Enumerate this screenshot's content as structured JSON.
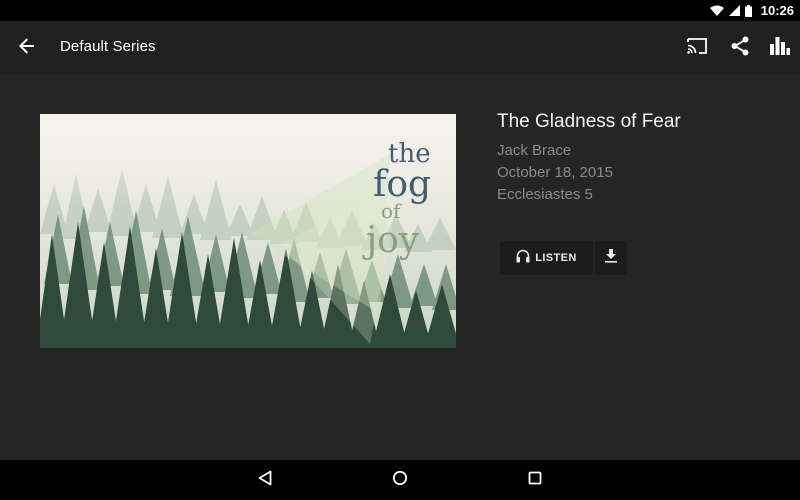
{
  "status_bar": {
    "time": "10:26",
    "icons": [
      "wifi-icon",
      "cellular-icon",
      "battery-icon"
    ]
  },
  "app_bar": {
    "title": "Default Series",
    "actions": [
      "cast-icon",
      "share-icon",
      "stats-icon"
    ]
  },
  "sermon": {
    "title": "The Gladness of Fear",
    "speaker": "Jack Brace",
    "date": "October 18, 2015",
    "scripture": "Ecclesiastes 5"
  },
  "artwork": {
    "words": [
      "the",
      "fog",
      "of",
      "joy"
    ]
  },
  "buttons": {
    "listen_label": "LISTEN"
  },
  "nav_bar": {
    "icons": [
      "back-triangle-icon",
      "home-circle-icon",
      "recents-square-icon"
    ]
  },
  "colors": {
    "app_bar": "#202020",
    "content_bg": "#252525",
    "title_text": "#f2f2f2",
    "meta_text": "#8a8a8a",
    "button_bg": "#1c1c1c"
  }
}
